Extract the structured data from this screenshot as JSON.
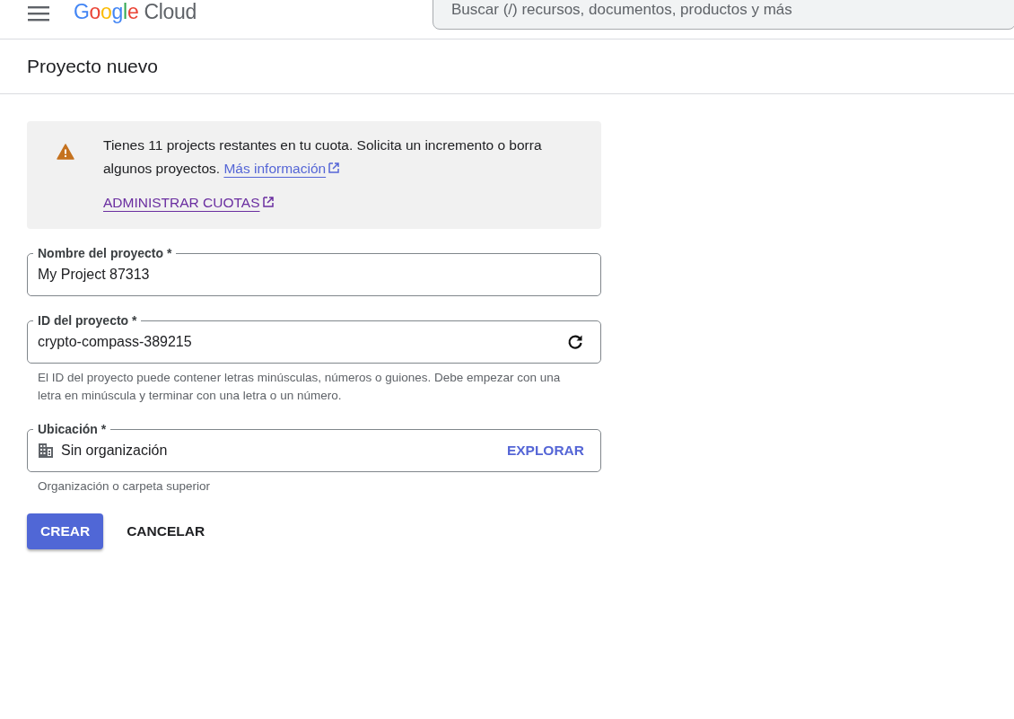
{
  "header": {
    "logo": {
      "brand": "Google",
      "product": "Cloud"
    },
    "search": {
      "placeholder": "Buscar (/) recursos, documentos, productos y más"
    }
  },
  "page_title": "Proyecto nuevo",
  "notice": {
    "text": "Tienes 11 projects restantes en tu cuota. Solicita un incremento o borra algunos proyectos.",
    "link": "Más información",
    "action": "ADMINISTRAR CUOTAS"
  },
  "fields": [
    {
      "kind": "text",
      "label": "Nombre del proyecto *",
      "value": "My Project 87313"
    },
    {
      "kind": "refresh",
      "label": "ID del proyecto *",
      "value": "crypto-compass-389215",
      "helper": "El ID del proyecto puede contener letras minúsculas, números o guiones. Debe empezar con una letra en minúscula y terminar con una letra o un número."
    },
    {
      "kind": "picker",
      "label": "Ubicación *",
      "value": "Sin organización",
      "action": "EXPLORAR",
      "helper": "Organización o carpeta superior"
    }
  ],
  "buttons": [
    {
      "kind": "primary",
      "label": "CREAR"
    },
    {
      "kind": "text",
      "label": "CANCELAR"
    }
  ]
}
